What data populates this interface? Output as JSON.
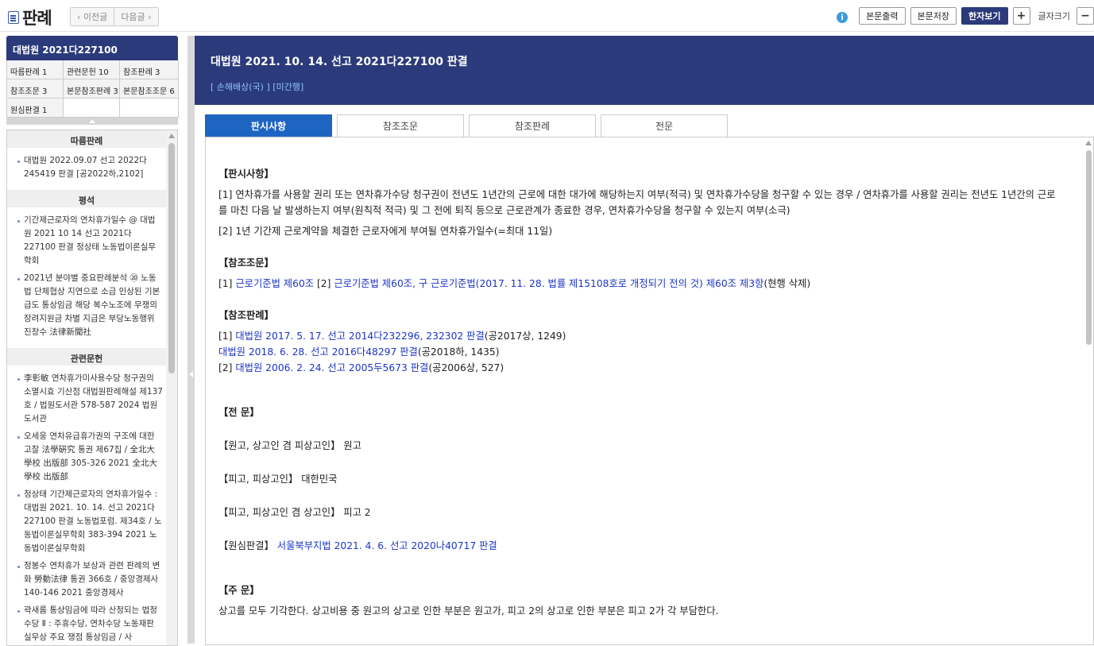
{
  "header": {
    "logo_text": "판례",
    "prev_label": "‹ 이전글",
    "next_label": "다음글 ›",
    "info_icon": "i",
    "print_label": "본문출력",
    "save_label": "본문저장",
    "hanja_label": "한자보기",
    "plus_label": "+",
    "minus_label": "−",
    "fontsize_label": "글자크기"
  },
  "sidebar": {
    "case_title": "대법원 2021다227100",
    "grid": [
      "따름판례 1",
      "관련문헌 10",
      "참조판례 3",
      "참조조문 3",
      "본문참조판례 3",
      "본문참조조문 6",
      "원심판결 1"
    ],
    "sections": [
      {
        "title": "따름판례",
        "items": [
          "대법원 2022.09.07 선고 2022다245419 판결 [공2022하,2102]"
        ]
      },
      {
        "title": "평석",
        "items": [
          "기간제근로자의 연차휴가일수 @ 대법원 2021 10 14 선고 2021다227100 판결 정상태 노동법이론실무학회",
          "2021년 분야별 중요판례분석 ⑳ 노동법 단체협상 지연으로 소급 인상된 기본급도 통상임금 해당 복수노조에 무쟁의 장려지원금 차별 지급은 부당노동행위 진창수 法律新聞社"
        ]
      },
      {
        "title": "관련문헌",
        "items": [
          "李彰敏 연차휴가미사용수당 청구권의 소멸시효 기산점 대법원판례해설 제137호 / 법원도서관 578-587 2024 법원도서관",
          "오세웅 연차유급휴가권의 구조에 대한 고찰 法學硏究 통권 제67집 / 全北大學校 出版部 305-326 2021 全北大學校 出版部",
          "정상태 기간제근로자의 연차휴가일수 : 대법원 2021. 10. 14. 선고 2021다227100 판결 노동법포럼. 제34호 / 노동법이론실무학회 383-394 2021 노동법이론실무학회",
          "정봉수 연차휴가 보상과 관련 판례의 변화 勞動法律 통권 366호 / 중앙경제사 140-146 2021 중앙경제사",
          "곽새롬 통상임금에 따라 산정되는 법정수당 Ⅱ : 주휴수당, 연차수당 노동재판 실무상 주요 쟁점 통상임금 / 사"
        ]
      }
    ]
  },
  "main": {
    "title": "대법원 2021. 10. 14. 선고 2021다227100 판결",
    "subtitle": "[ 손해배상(국) ] [미간행]",
    "tabs": [
      "판시사항",
      "참조조문",
      "참조판례",
      "전문"
    ],
    "active_tab": 0,
    "doc": {
      "h_issues": "【판시사항】",
      "issue1": "[1] 연차휴가를 사용할 권리 또는 연차휴가수당 청구권이 전년도 1년간의 근로에 대한 대가에 해당하는지 여부(적극) 및 연차휴가수당을 청구할 수 있는 경우 / 연차휴가를 사용할 권리는 전년도 1년간의 근로를 마친 다음 날 발생하는지 여부(원칙적 적극) 및 그 전에 퇴직 등으로 근로관계가 종료한 경우, 연차휴가수당을 청구할 수 있는지 여부(소극)",
      "issue2": "[2] 1년 기간제 근로계약을 체결한 근로자에게 부여될 연차휴가일수(=최대 11일)",
      "h_statutes": "【참조조문】",
      "st_pre1": "[1] ",
      "st_link1": "근로기준법 제60조",
      "st_pre2": " [2] ",
      "st_link2": "근로기준법 제60조, 구 근로기준법(2017. 11. 28. 법률 제15108호로 개정되기 전의 것) 제60조 제3항",
      "st_post": "(현행 삭제)",
      "h_precedents": "【참조판례】",
      "pr1_pre": "[1] ",
      "pr1_link": "대법원 2017. 5. 17. 선고 2014다232296, 232302 판결",
      "pr1_post": "(공2017상, 1249)",
      "pr2_link": "대법원 2018. 6. 28. 선고 2016다48297 판결",
      "pr2_post": "(공2018하, 1435)",
      "pr3_pre": "[2] ",
      "pr3_link": "대법원 2006. 2. 24. 선고 2005두5673 판결",
      "pr3_post": "(공2006상, 527)",
      "h_full": "【전 문】",
      "plaintiff": "【원고, 상고인 겸 피상고인】  원고",
      "defendant1": "【피고, 피상고인】  대한민국",
      "defendant2": "【피고, 피상고인 겸 상고인】  피고 2",
      "lower_label": "【원심판결】  ",
      "lower_link": "서울북부지법 2021. 4. 6. 선고 2020나40717 판결",
      "h_order": "【주 문】",
      "order_text": "상고를 모두 기각한다. 상고비용 중 원고의 상고로 인한 부분은 원고가, 피고 2의 상고로 인한 부분은 피고 2가 각 부담한다."
    }
  }
}
